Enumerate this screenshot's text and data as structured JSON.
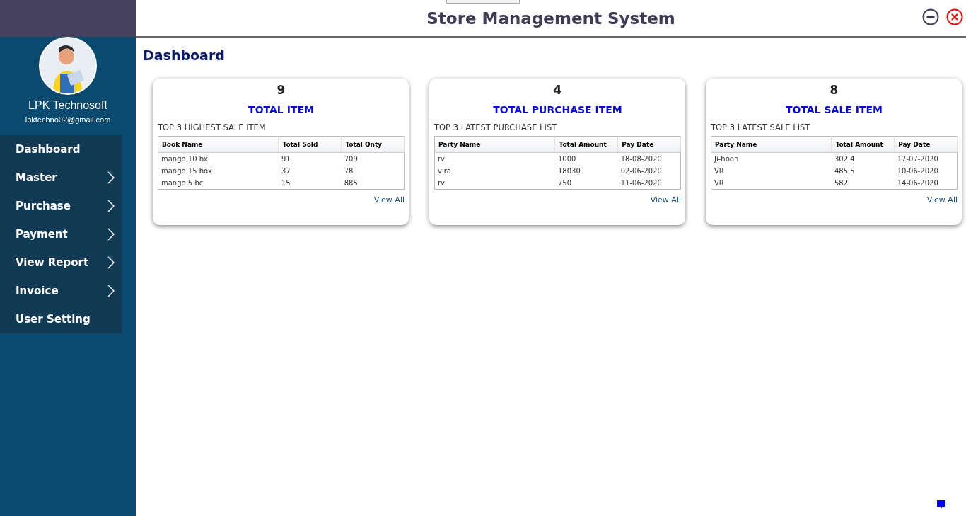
{
  "window": {
    "title": "Store Management System"
  },
  "sidebar": {
    "user_name": "LPK Technosoft",
    "user_email": "lpktechno02@gmail.com",
    "items": [
      {
        "label": "Dashboard",
        "has_submenu": false
      },
      {
        "label": "Master",
        "has_submenu": true
      },
      {
        "label": "Purchase",
        "has_submenu": true
      },
      {
        "label": "Payment",
        "has_submenu": true
      },
      {
        "label": "View Report",
        "has_submenu": true
      },
      {
        "label": "Invoice",
        "has_submenu": true
      },
      {
        "label": "User Setting",
        "has_submenu": false
      }
    ]
  },
  "page_title": "Dashboard",
  "cards": [
    {
      "count": "9",
      "title": "TOTAL ITEM",
      "subtitle": "TOP 3 HIGHEST SALE ITEM",
      "columns": [
        "Book Name",
        "Total Sold",
        "Total Qnty"
      ],
      "rows": [
        [
          "mango 10 bx",
          "91",
          "709"
        ],
        [
          "mango 15 box",
          "37",
          "78"
        ],
        [
          "mango 5 bc",
          "15",
          "885"
        ]
      ],
      "link": "View All"
    },
    {
      "count": "4",
      "title": "TOTAL PURCHASE ITEM",
      "subtitle": "TOP 3 LATEST PURCHASE LIST",
      "columns": [
        "Party Name",
        "Total Amount",
        "Pay Date"
      ],
      "rows": [
        [
          "rv",
          "1000",
          "18-08-2020"
        ],
        [
          "vira",
          "18030",
          "02-06-2020"
        ],
        [
          "rv",
          "750",
          "11-06-2020"
        ]
      ],
      "link": "View All"
    },
    {
      "count": "8",
      "title": "TOTAL SALE ITEM",
      "subtitle": "TOP 3 LATEST SALE LIST",
      "columns": [
        "Party Name",
        "Total Amount",
        "Pay Date"
      ],
      "rows": [
        [
          "Ji-hoon",
          "302.4",
          "17-07-2020"
        ],
        [
          "VR",
          "485.5",
          "10-06-2020"
        ],
        [
          "VR",
          "582",
          "14-06-2020"
        ]
      ],
      "link": "View All"
    }
  ]
}
